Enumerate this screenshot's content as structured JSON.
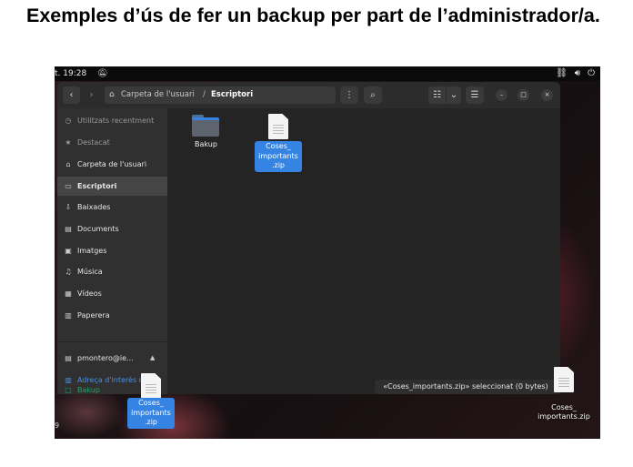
{
  "page_title": "Exemples d’ús de fer un backup per part de l’administrador/a.",
  "topbar": {
    "clock": "t. 19:28",
    "icons": [
      "bell-off-icon",
      "network-icon",
      "volume-icon",
      "power-icon"
    ]
  },
  "header": {
    "back_label": "‹",
    "forward_label": "›",
    "path": [
      "Carpeta de l'usuari",
      "Escriptori"
    ],
    "path_separator": "/",
    "menu_label": "⋮",
    "search_label": "⌕",
    "view_list_label": "☷",
    "view_toggle_label": "⌄",
    "main_menu_label": "☰",
    "minimize_label": "–",
    "maximize_label": "□",
    "close_label": "×"
  },
  "sidebar": {
    "items": [
      {
        "label": "Utilitzats recentment",
        "icon": "clock-icon",
        "glyph": "◷"
      },
      {
        "label": "Destacat",
        "icon": "star-icon",
        "glyph": "★"
      },
      {
        "label": "Carpeta de l'usuari",
        "icon": "home-icon",
        "glyph": "⌂"
      },
      {
        "label": "Escriptori",
        "icon": "desktop-icon",
        "glyph": "▭"
      },
      {
        "label": "Baixades",
        "icon": "download-icon",
        "glyph": "⇩"
      },
      {
        "label": "Documents",
        "icon": "document-icon",
        "glyph": "▤"
      },
      {
        "label": "Imatges",
        "icon": "image-icon",
        "glyph": "▣"
      },
      {
        "label": "Música",
        "icon": "music-icon",
        "glyph": "♫"
      },
      {
        "label": "Vídeos",
        "icon": "video-icon",
        "glyph": "▦"
      },
      {
        "label": "Paperera",
        "icon": "trash-icon",
        "glyph": "🗑"
      },
      {
        "label": "pmontero@ie...",
        "icon": "network-drive-icon",
        "glyph": "▤"
      },
      {
        "label": "Adreça d'interès n...",
        "icon": "link-icon",
        "glyph": "▥"
      },
      {
        "label": "Bakup",
        "icon": "folder-icon",
        "glyph": "▢"
      }
    ],
    "eject_label": "▲"
  },
  "content": {
    "files": [
      {
        "name": "Bakup",
        "icon": "folder-icon"
      },
      {
        "name_lines": [
          "Coses_",
          "importants",
          ".zip"
        ],
        "icon": "zip-file-icon",
        "selected": true
      }
    ]
  },
  "status": {
    "text": "«Coses_importants.zip» seleccionat  (0 bytes)"
  },
  "desktop": {
    "dragged_file_lines": [
      "Coses_",
      "importants",
      ".zip"
    ],
    "desktop_file_lines": [
      "Coses_",
      "importants.zip"
    ],
    "corner_text": "9"
  },
  "colors": {
    "accent": "#3584e4",
    "window_bg": "#242424",
    "sidebar_bg": "#303030",
    "link": "#4a90e2",
    "green": "#26a269"
  }
}
